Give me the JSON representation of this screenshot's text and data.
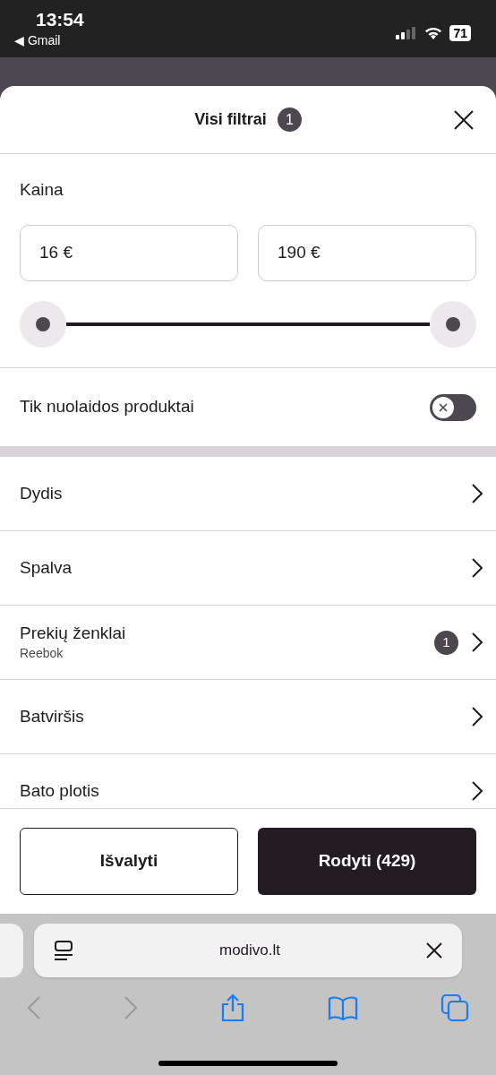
{
  "status_bar": {
    "time": "13:54",
    "back_app": "◀ Gmail",
    "battery": "71"
  },
  "sheet": {
    "title": "Visi filtrai",
    "count": "1"
  },
  "price": {
    "label": "Kaina",
    "min_value": "16 €",
    "max_value": "190 €"
  },
  "discount_toggle": {
    "label": "Tik nuolaidos produktai",
    "on": false
  },
  "filters": [
    {
      "label": "Dydis"
    },
    {
      "label": "Spalva"
    },
    {
      "label": "Prekių ženklai",
      "value": "Reebok",
      "count": "1"
    },
    {
      "label": "Batviršis"
    },
    {
      "label": "Bato plotis"
    }
  ],
  "buttons": {
    "clear": "Išvalyti",
    "show": "Rodyti (429)"
  },
  "browser": {
    "url": "modivo.lt"
  }
}
